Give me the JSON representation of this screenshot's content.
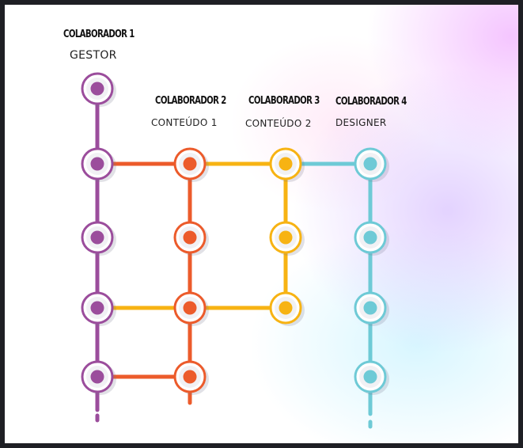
{
  "collaborators": [
    {
      "name": "COLABORADOR 1",
      "role": "GESTOR",
      "color": "#9b4d9c"
    },
    {
      "name": "COLABORADOR 2",
      "role": "CONTEÚDO 1",
      "color": "#ec5b2b"
    },
    {
      "name": "COLABORADOR 3",
      "role": "CONTEÚDO 2",
      "color": "#f7b313"
    },
    {
      "name": "COLABORADOR 4",
      "role": "DESIGNER",
      "color": "#6ecad6"
    }
  ]
}
